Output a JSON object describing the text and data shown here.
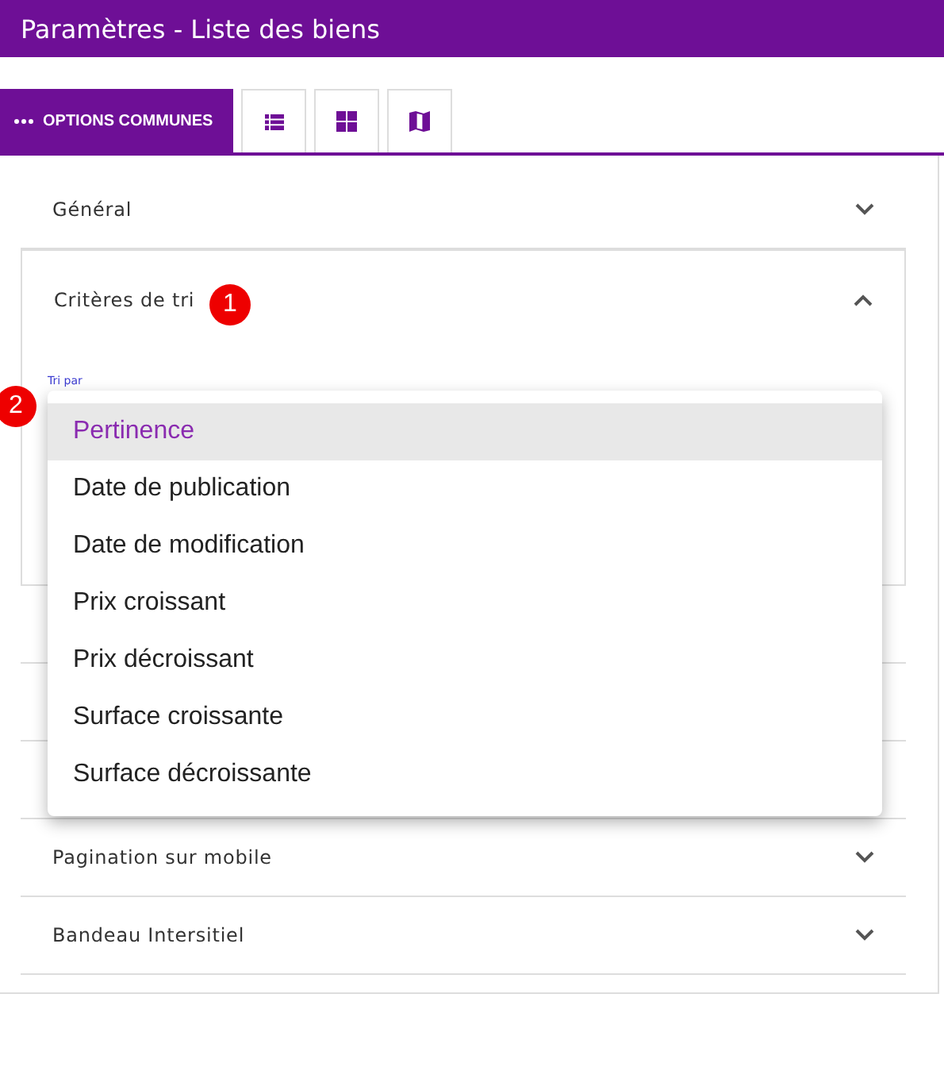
{
  "header": {
    "title": "Paramètres - Liste des biens"
  },
  "tabs": [
    {
      "kind": "text",
      "label": "OPTIONS COMMUNES",
      "selected": true
    },
    {
      "kind": "list",
      "selected": false
    },
    {
      "kind": "grid",
      "selected": false
    },
    {
      "kind": "map",
      "selected": false
    }
  ],
  "sections": [
    {
      "title": "Général",
      "expanded": false
    },
    {
      "title": "Critères de tri",
      "expanded": true,
      "badge": "1",
      "field": {
        "label": "Tri par",
        "badge": "2"
      }
    },
    {
      "title": "Pagination sur mobile",
      "expanded": false
    },
    {
      "title": "Bandeau Intersitiel",
      "expanded": false
    }
  ],
  "menu": {
    "options": [
      {
        "label": "Pertinence",
        "selected": true
      },
      {
        "label": "Date de publication",
        "selected": false
      },
      {
        "label": "Date de modification",
        "selected": false
      },
      {
        "label": "Prix croissant",
        "selected": false
      },
      {
        "label": "Prix décroissant",
        "selected": false
      },
      {
        "label": "Surface croissante",
        "selected": false
      },
      {
        "label": "Surface décroissante",
        "selected": false
      }
    ]
  }
}
